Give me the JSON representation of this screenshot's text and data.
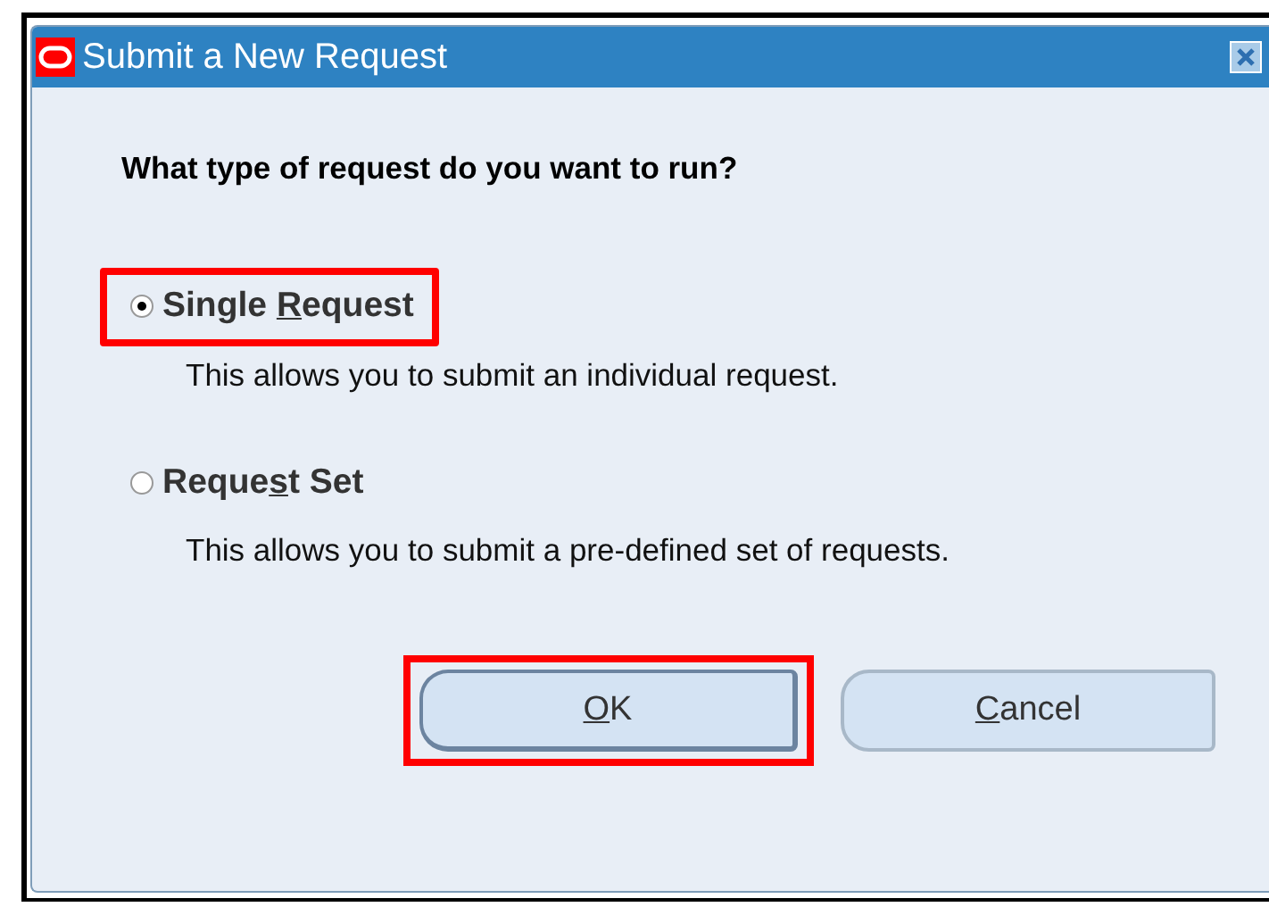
{
  "window": {
    "title": "Submit a New Request"
  },
  "question": "What type of request do you want to run?",
  "options": [
    {
      "label": [
        {
          "text": "Single ",
          "underlined": false
        },
        {
          "text": "R",
          "underlined": true
        },
        {
          "text": "equest",
          "underlined": false
        }
      ],
      "description": "This allows you to submit an individual request.",
      "selected": true,
      "highlighted": true
    },
    {
      "label": [
        {
          "text": "Reque",
          "underlined": false
        },
        {
          "text": "s",
          "underlined": true
        },
        {
          "text": "t Set",
          "underlined": false
        }
      ],
      "description": "This allows you to submit a pre-defined set of requests.",
      "selected": false,
      "highlighted": false
    }
  ],
  "buttons": [
    {
      "label": [
        {
          "text": "O",
          "underlined": true
        },
        {
          "text": "K",
          "underlined": false
        }
      ],
      "default": true,
      "highlighted": true
    },
    {
      "label": [
        {
          "text": "C",
          "underlined": true
        },
        {
          "text": "ancel",
          "underlined": false
        }
      ],
      "default": false,
      "highlighted": false
    }
  ]
}
